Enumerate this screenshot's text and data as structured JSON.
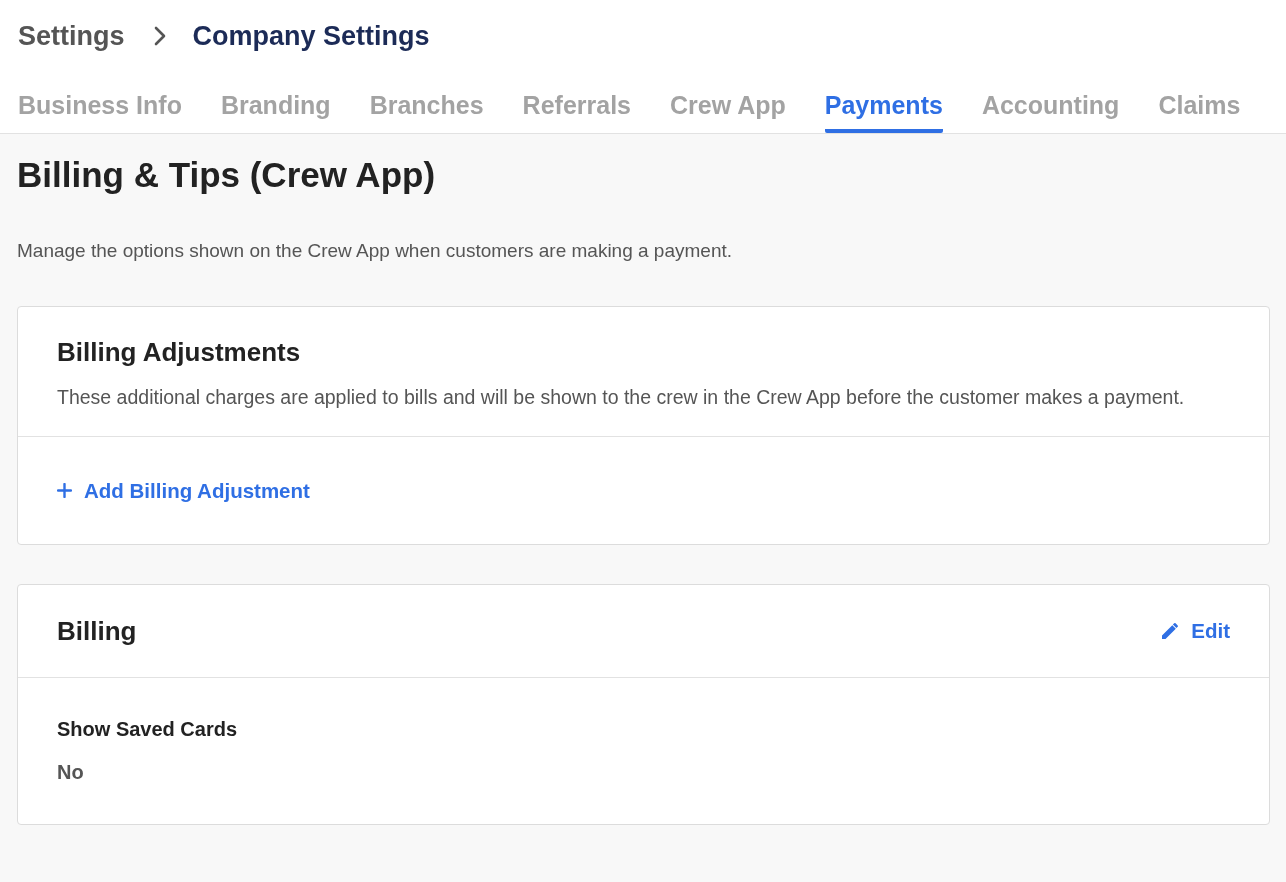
{
  "breadcrumb": [
    {
      "label": "Settings"
    },
    {
      "label": "Company Settings"
    }
  ],
  "tabs": [
    {
      "label": "Business Info",
      "selected": false
    },
    {
      "label": "Branding",
      "selected": false
    },
    {
      "label": "Branches",
      "selected": false
    },
    {
      "label": "Referrals",
      "selected": false
    },
    {
      "label": "Crew App",
      "selected": false
    },
    {
      "label": "Payments",
      "selected": true
    },
    {
      "label": "Accounting",
      "selected": false
    },
    {
      "label": "Claims",
      "selected": false
    }
  ],
  "page": {
    "title": "Billing & Tips (Crew App)",
    "description": "Manage the options shown on the Crew App when customers are making a payment."
  },
  "adjustments_card": {
    "title": "Billing Adjustments",
    "description": "These additional charges are applied to bills and will be shown to the crew in the Crew App before the customer makes a payment.",
    "add_link": "Add Billing Adjustment"
  },
  "billing_card": {
    "title": "Billing",
    "edit_link": "Edit",
    "fields": [
      {
        "label": "Show Saved Cards",
        "value": "No"
      }
    ]
  }
}
